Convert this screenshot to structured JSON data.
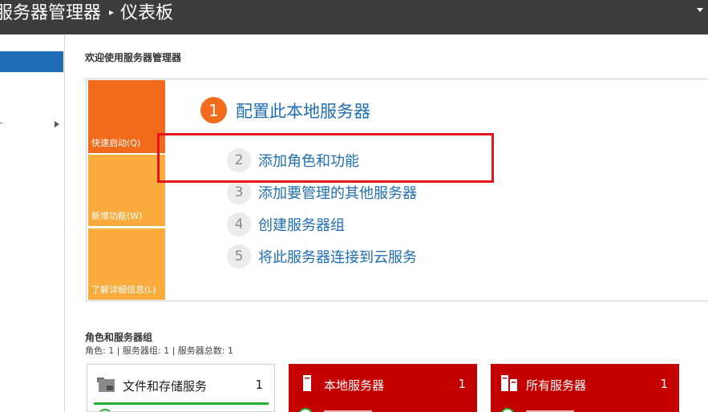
{
  "header": {
    "app_title": "服务器管理器",
    "separator": "▸",
    "page": "仪表板"
  },
  "welcome_heading": "欢迎使用服务器管理器",
  "quick_start": {
    "tiles": [
      {
        "label": "快速启动(Q)",
        "color": "#f26b1d"
      },
      {
        "label": "新增功能(W)",
        "color": "#f9ab3b"
      },
      {
        "label": "了解详细信息(L)",
        "color": "#f9ab3b"
      }
    ],
    "main_step": {
      "number": "1",
      "label": "配置此本地服务器"
    },
    "steps": [
      {
        "number": "2",
        "label": "添加角色和功能"
      },
      {
        "number": "3",
        "label": "添加要管理的其他服务器"
      },
      {
        "number": "4",
        "label": "创建服务器组"
      },
      {
        "number": "5",
        "label": "将此服务器连接到云服务"
      }
    ]
  },
  "roles": {
    "title": "角色和服务器组",
    "summary": "角色: 1 | 服务器组: 1 | 服务器总数: 1",
    "cards": [
      {
        "name": "文件和存储服务",
        "count": "1",
        "icon": "file-storage-icon",
        "status_color": "#21b231"
      },
      {
        "name": "本地服务器",
        "count": "1",
        "icon": "server-icon",
        "color": "#c40000"
      },
      {
        "name": "所有服务器",
        "count": "1",
        "icon": "servers-icon",
        "color": "#c40000"
      }
    ]
  },
  "colors": {
    "accent_blue": "#1f6eb5",
    "highlight_red": "#e8141c",
    "titlebar": "#3c3c3c"
  }
}
